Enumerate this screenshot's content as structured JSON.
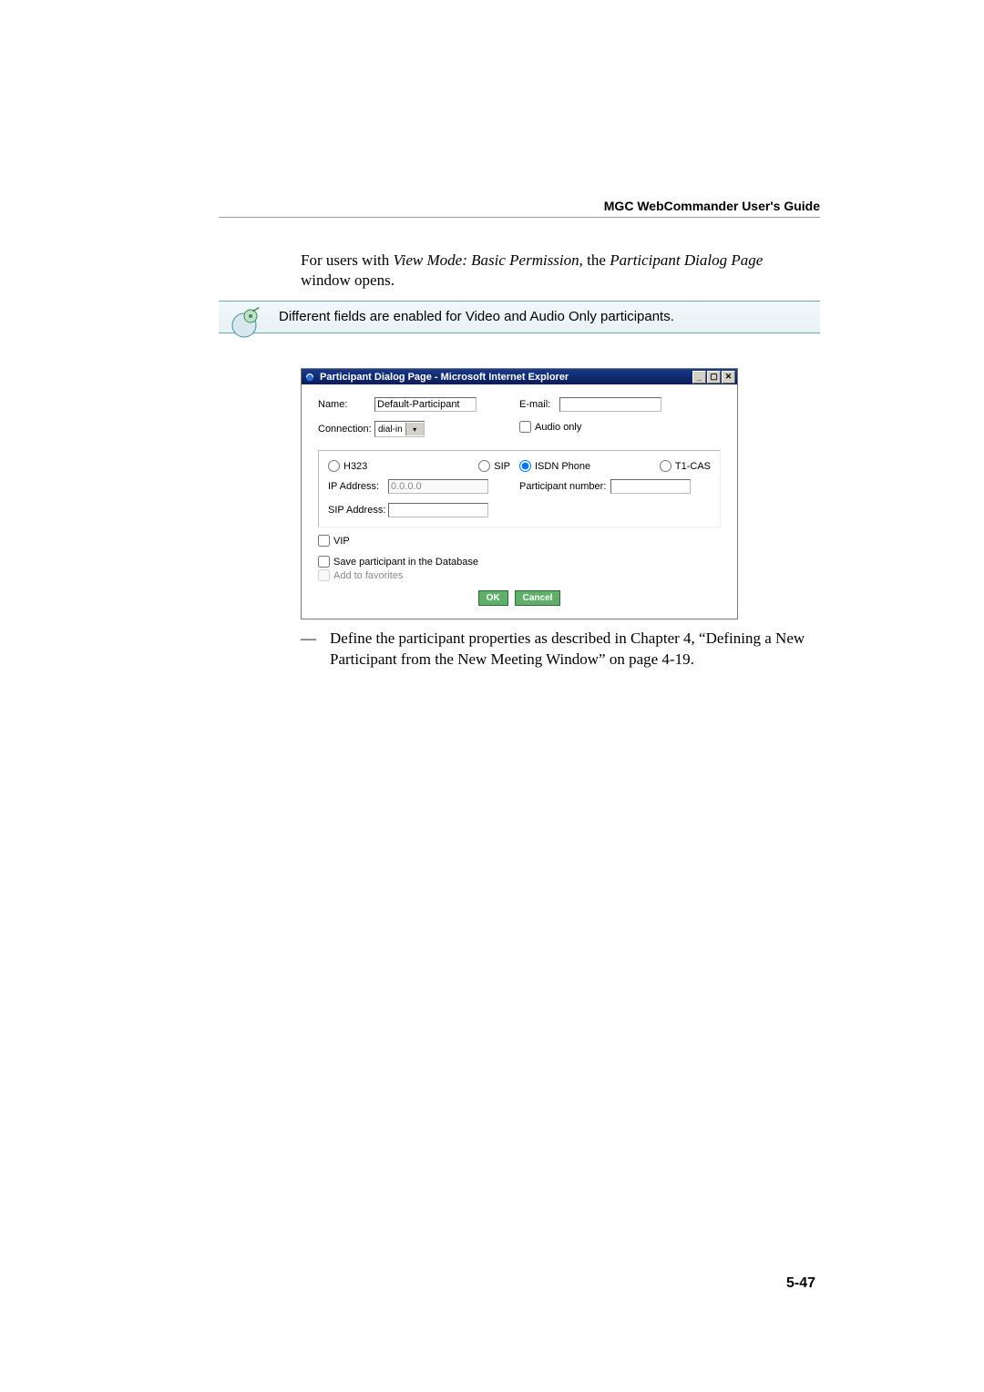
{
  "header": {
    "guide_title": "MGC WebCommander User's Guide"
  },
  "intro": {
    "prefix": "For users with ",
    "italic1": "View Mode: Basic Permission,",
    "mid": " the ",
    "italic2": "Participant Dialog Page",
    "suffix": " window opens."
  },
  "note": {
    "text": "Different fields are enabled for Video and Audio Only participants."
  },
  "dialog": {
    "title": "Participant Dialog Page - Microsoft Internet Explorer",
    "labels": {
      "name": "Name:",
      "connection": "Connection:",
      "email": "E-mail:",
      "audio_only": "Audio only",
      "h323": "H323",
      "sip": "SIP",
      "isdn": "ISDN Phone",
      "t1cas": "T1-CAS",
      "ip_address": "IP Address:",
      "sip_address": "SIP Address:",
      "participant_number": "Participant number:",
      "vip": "VIP",
      "save_db": "Save participant in the Database",
      "add_fav": "Add to favorites"
    },
    "values": {
      "name": "Default-Participant",
      "connection": "dial-in",
      "email": "",
      "ip_address": "0.0.0.0",
      "sip_address": "",
      "participant_number": ""
    },
    "buttons": {
      "ok": "OK",
      "cancel": "Cancel"
    },
    "wincontrols": {
      "min": "_",
      "max": "▢",
      "close": "✕"
    }
  },
  "after": {
    "dash": "—",
    "text": "Define the participant properties as described in Chapter  4, “Defining a New Participant from the New Meeting Window” on page 4-19."
  },
  "page_number": "5-47"
}
